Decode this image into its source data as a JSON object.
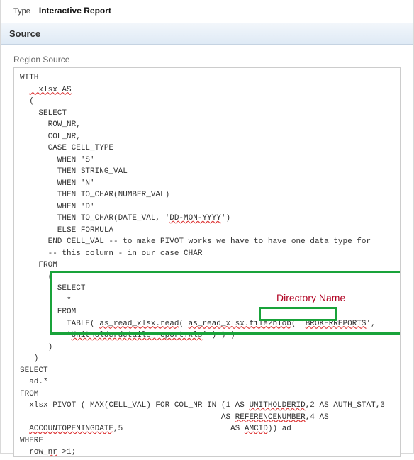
{
  "header": {
    "type_label": "Type",
    "type_value": "Interactive Report",
    "section_title": "Source",
    "region_source_label": "Region Source"
  },
  "code": {
    "l01": "WITH",
    "l02": "  xlsx AS",
    "l03": "  (",
    "l04": "    SELECT",
    "l05a": "      ROW_NR,",
    "l05b": "      COL_NR,",
    "l06": "      CASE CELL_TYPE",
    "l07": "        WHEN 'S'",
    "l08": "        THEN STRING_VAL",
    "l09": "        WHEN 'N'",
    "l10": "        THEN TO_CHAR(NUMBER_VAL)",
    "l11": "        WHEN 'D'",
    "l12a": "        THEN TO_CHAR(DATE_VAL, '",
    "l12b": "DD-MON-YYYY",
    "l12c": "')",
    "l13": "        ELSE FORMULA",
    "l14": "      END CELL_VAL -- to make PIVOT works we have to have one data type for",
    "l15": "      -- this column - in our case CHAR",
    "l16": "    FROM",
    "l17": "      (",
    "l18": "        SELECT",
    "l19": "          *",
    "l20": "        FROM",
    "l21a": "          TABLE( ",
    "l21b": "as_read_xlsx.read",
    "l21c": "( ",
    "l21d": "as_read_xlsx.file2blob",
    "l21e": "( '",
    "l21f": "BROKERREPORTS",
    "l21g": "',",
    "l22a": "          '",
    "l22b": "Unitholderdetails_report.xls",
    "l22c": "' ) ) )",
    "l23": "      )",
    "l24": "   )",
    "l25": "SELECT",
    "l26": "  ad.*",
    "l27": "FROM",
    "l28a": "  xlsx PIVOT ( MAX(CELL_VAL) FOR COL_NR IN (1 AS ",
    "l28b": "UNITHOLDERID",
    "l28c": ",2 AS AUTH_STAT,3",
    "l29a": "                                           AS ",
    "l29b": "REFERENCENUMBER",
    "l29c": ",4 AS",
    "l30a": "  ",
    "l30b": "ACCOUNTOPENINGDATE",
    "l30c": ",5                       AS ",
    "l30d": "AMCID",
    "l30e": ")) ad",
    "l31": "WHERE",
    "l32a": "  row_",
    "l32b": "nr",
    "l32c": " >1;"
  },
  "annotation": {
    "directory_name": "Directory Name"
  }
}
